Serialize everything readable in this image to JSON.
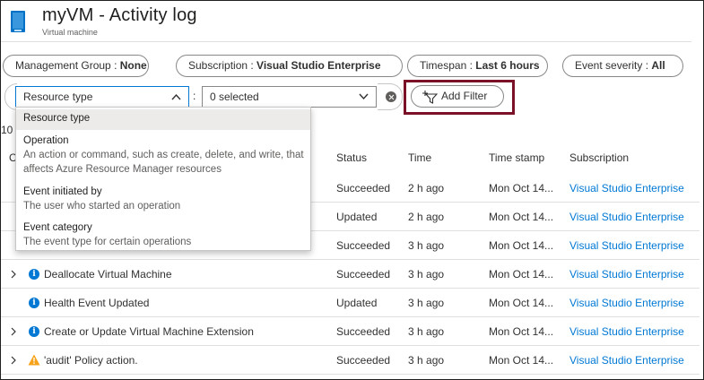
{
  "header": {
    "title": "myVM - Activity log",
    "subtitle": "Virtual machine",
    "icon": "virtual-machine-icon"
  },
  "filters": {
    "management_group": {
      "label": "Management Group : ",
      "value": "None"
    },
    "subscription": {
      "label": "Subscription : ",
      "value": "Visual Studio Enterprise"
    },
    "timespan": {
      "label": "Timespan : ",
      "value": "Last 6 hours"
    },
    "event_severity": {
      "label": "Event severity : ",
      "value": "All"
    }
  },
  "custom_filter": {
    "field_value": "Resource type",
    "separator": ":",
    "selection_value": "0 selected"
  },
  "add_filter": {
    "label": "Add Filter"
  },
  "dropdown": {
    "items": [
      {
        "title": "Resource type",
        "description": ""
      },
      {
        "title": "Operation",
        "description": "An action or command, such as create, delete, and write, that affects Azure Resource Manager resources"
      },
      {
        "title": "Event initiated by",
        "description": "The user who started an operation"
      },
      {
        "title": "Event category",
        "description": "The event type for certain operations"
      }
    ]
  },
  "table": {
    "count_fragment": "10",
    "first_col_fragment": "C",
    "columns": [
      "Status",
      "Time",
      "Time stamp",
      "Subscription"
    ],
    "rows": [
      {
        "operation": "",
        "status": "Succeeded",
        "time": "2 h ago",
        "stamp": "Mon Oct 14...",
        "subscription": "Visual Studio Enterprise"
      },
      {
        "operation": "",
        "status": "Updated",
        "time": "2 h ago",
        "stamp": "Mon Oct 14...",
        "subscription": "Visual Studio Enterprise"
      },
      {
        "operation": "",
        "status": "Succeeded",
        "time": "3 h ago",
        "stamp": "Mon Oct 14...",
        "subscription": "Visual Studio Enterprise"
      },
      {
        "operation": "Deallocate Virtual Machine",
        "status": "Succeeded",
        "time": "3 h ago",
        "stamp": "Mon Oct 14...",
        "subscription": "Visual Studio Enterprise"
      },
      {
        "operation": "Health Event Updated",
        "status": "Updated",
        "time": "3 h ago",
        "stamp": "Mon Oct 14...",
        "subscription": "Visual Studio Enterprise"
      },
      {
        "operation": "Create or Update Virtual Machine Extension",
        "status": "Succeeded",
        "time": "3 h ago",
        "stamp": "Mon Oct 14...",
        "subscription": "Visual Studio Enterprise"
      },
      {
        "operation": "'audit' Policy action.",
        "status": "Succeeded",
        "time": "3 h ago",
        "stamp": "Mon Oct 14...",
        "subscription": "Visual Studio Enterprise"
      }
    ]
  },
  "colors": {
    "accent": "#0078d4",
    "highlight": "#7a1126",
    "warning": "#f7a21b"
  }
}
